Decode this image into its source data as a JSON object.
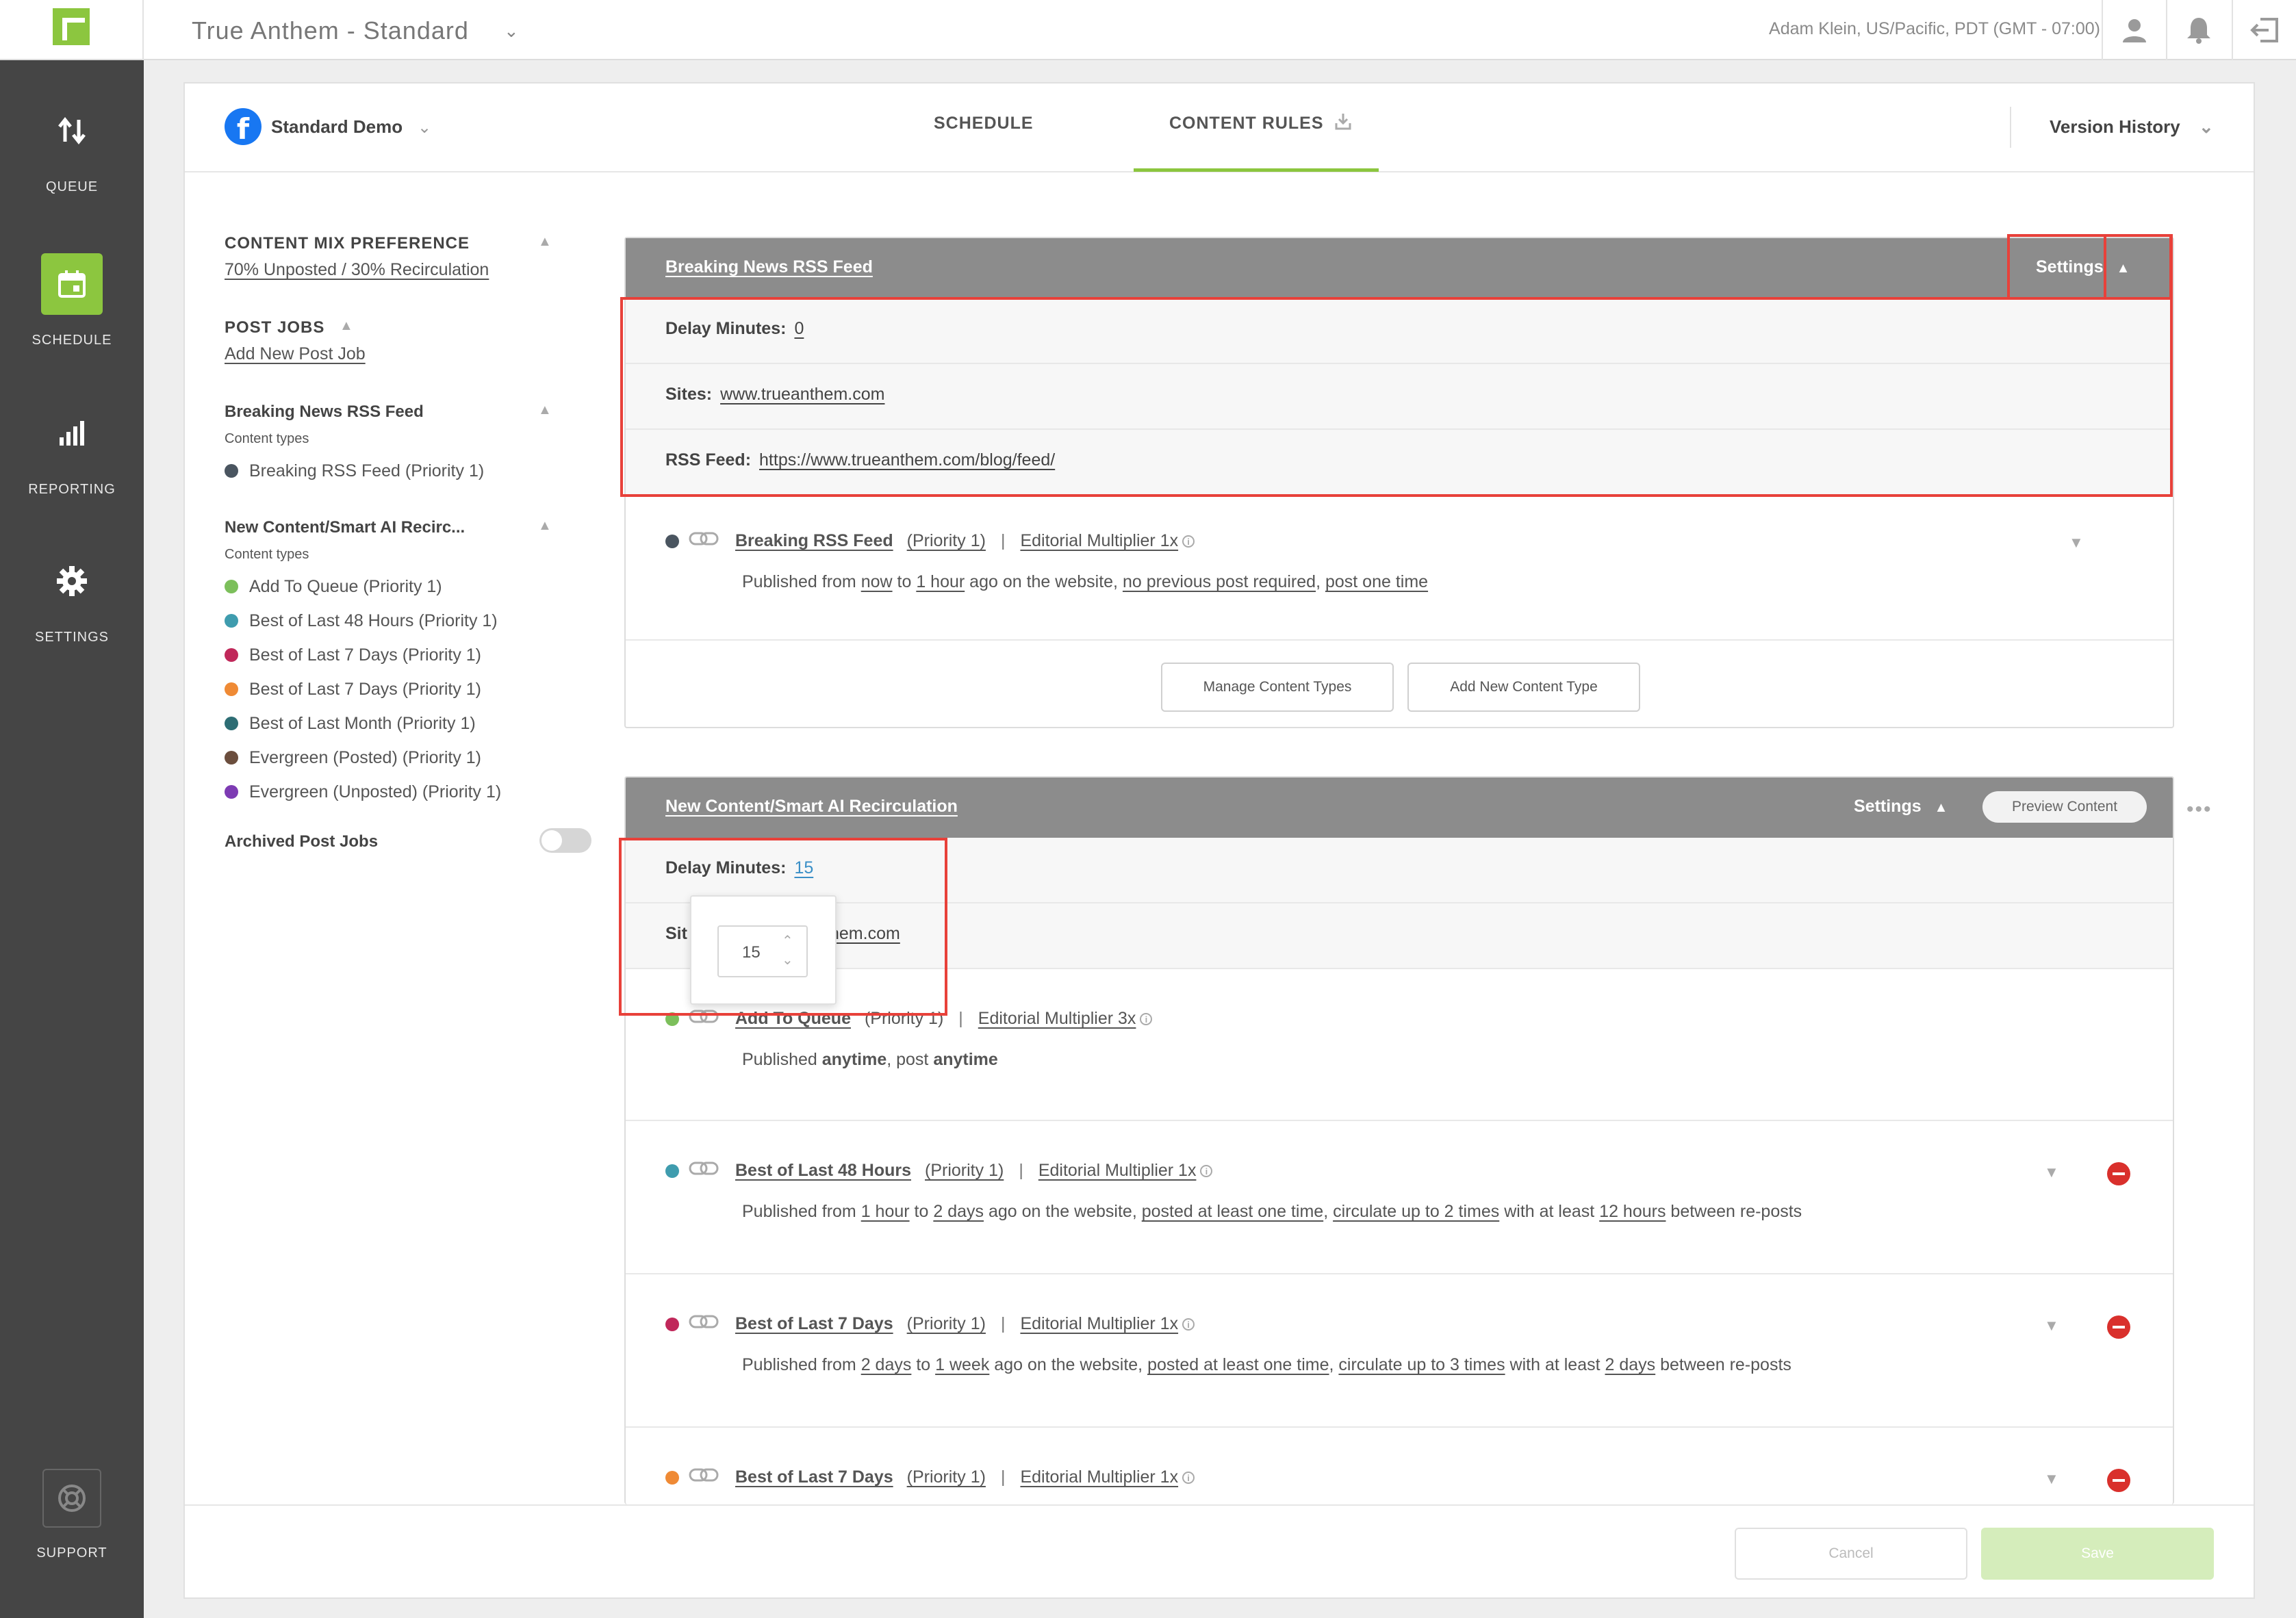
{
  "topbar": {
    "app_title": "True Anthem - Standard",
    "user_info": "Adam Klein, US/Pacific, PDT (GMT - 07:00)",
    "icons": [
      "user-icon",
      "bell-icon",
      "logout-icon"
    ]
  },
  "sidebar": {
    "items": [
      {
        "label": "QUEUE",
        "icon": "sort-arrows-icon"
      },
      {
        "label": "SCHEDULE",
        "icon": "calendar-icon",
        "active": true
      },
      {
        "label": "REPORTING",
        "icon": "bar-chart-icon"
      },
      {
        "label": "SETTINGS",
        "icon": "gear-icon"
      },
      {
        "label": "SUPPORT",
        "icon": "lifebuoy-icon"
      }
    ]
  },
  "header": {
    "account": "Standard Demo",
    "tabs": [
      {
        "label": "SCHEDULE"
      },
      {
        "label": "CONTENT RULES",
        "active": true
      }
    ],
    "version_history": "Version History"
  },
  "left": {
    "mix_title": "CONTENT MIX PREFERENCE",
    "mix_value": "70% Unposted / 30% Recirculation",
    "post_jobs_title": "POST JOBS",
    "add_post_job": "Add New Post Job",
    "job1": {
      "title": "Breaking News RSS Feed",
      "content_types_label": "Content types",
      "items": [
        {
          "label": "Breaking RSS Feed (Priority 1)",
          "color": "#4a5560"
        }
      ]
    },
    "job2": {
      "title": "New Content/Smart AI Recirc...",
      "content_types_label": "Content types",
      "items": [
        {
          "label": "Add To Queue (Priority 1)",
          "color": "#7cbf5b"
        },
        {
          "label": "Best of Last 48 Hours (Priority 1)",
          "color": "#3f9cae"
        },
        {
          "label": "Best of Last 7 Days (Priority 1)",
          "color": "#c0285a"
        },
        {
          "label": "Best of Last 7 Days (Priority 1)",
          "color": "#ef8a35"
        },
        {
          "label": "Best of Last Month (Priority 1)",
          "color": "#2d6d74"
        },
        {
          "label": "Evergreen (Posted) (Priority 1)",
          "color": "#6b4e3d"
        },
        {
          "label": "Evergreen (Unposted) (Priority 1)",
          "color": "#7d3bb3"
        }
      ]
    },
    "archived_label": "Archived Post Jobs"
  },
  "panel1": {
    "title": "Breaking News RSS Feed",
    "settings_label": "Settings",
    "delay_label": "Delay Minutes:",
    "delay_value": "0",
    "sites_label": "Sites:",
    "sites_value": "www.trueanthem.com",
    "rss_label": "RSS Feed:",
    "rss_value": "https://www.trueanthem.com/blog/feed/",
    "rule": {
      "name": "Breaking RSS Feed",
      "priority": "(Priority 1)",
      "multiplier": "Editorial Multiplier 1x",
      "color": "#4a5560",
      "desc": {
        "pre": "Published from ",
        "from": "now",
        "to_word": " to ",
        "to": "1 hour",
        "mid": " ago on the website, ",
        "cond1": "no previous post required",
        "comma": ", ",
        "cond2": "post one time"
      }
    },
    "manage_btn": "Manage Content Types",
    "add_btn": "Add New Content Type"
  },
  "panel2": {
    "title": "New Content/Smart AI Recirculation",
    "settings_label": "Settings",
    "preview_label": "Preview Content",
    "delay_label": "Delay Minutes:",
    "delay_value": "15",
    "sites_label_partial": "Sit",
    "sites_value_partial": "hem.com",
    "stepper_value": "15",
    "rules": [
      {
        "name": "Add To Queue",
        "priority": "(Priority 1)",
        "multiplier": "Editorial Multiplier 3x",
        "color": "#7cbf5b",
        "desc_pre": "Published ",
        "desc_b1": "anytime",
        "desc_mid": ", post ",
        "desc_b2": "anytime"
      },
      {
        "name": "Best of Last 48 Hours",
        "priority": "(Priority 1)",
        "multiplier": "Editorial Multiplier 1x",
        "color": "#3f9cae",
        "desc": {
          "pre": "Published from ",
          "from": "1 hour",
          "to_word": " to ",
          "to": "2 days",
          "mid": " ago on the website, ",
          "cond1": "posted at least one time",
          "comma": ", ",
          "cond2": "circulate up to 2 times",
          "gap_pre": " with at least ",
          "gap": "12 hours",
          "post": " between re-posts"
        }
      },
      {
        "name": "Best of Last 7 Days",
        "priority": "(Priority 1)",
        "multiplier": "Editorial Multiplier 1x",
        "color": "#c0285a",
        "desc": {
          "pre": "Published from ",
          "from": "2 days",
          "to_word": " to ",
          "to": "1 week",
          "mid": " ago on the website, ",
          "cond1": "posted at least one time",
          "comma": ", ",
          "cond2": "circulate up to 3 times",
          "gap_pre": " with at least ",
          "gap": "2 days",
          "post": " between re-posts"
        }
      },
      {
        "name": "Best of Last 7 Days",
        "priority": "(Priority 1)",
        "multiplier": "Editorial Multiplier 1x",
        "color": "#ef8a35"
      }
    ]
  },
  "footer": {
    "cancel": "Cancel",
    "save": "Save"
  },
  "colors": {
    "accent": "#8cc63f",
    "highlight_box": "#e8413a",
    "remove": "#d9302c"
  }
}
